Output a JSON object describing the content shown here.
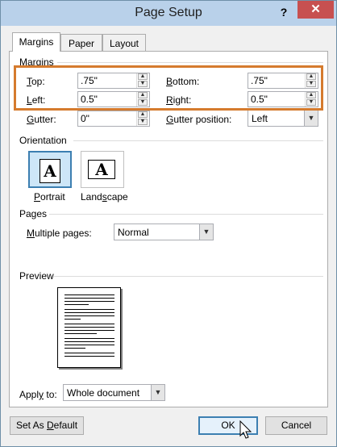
{
  "window": {
    "title": "Page Setup",
    "help_label": "?",
    "close_label": "✕"
  },
  "tabs": [
    {
      "label": "Margins",
      "active": true
    },
    {
      "label": "Paper",
      "active": false
    },
    {
      "label": "Layout",
      "active": false
    }
  ],
  "margins": {
    "section_label": "Margins",
    "top": {
      "label_first": "T",
      "label_rest": "op:",
      "value": ".75\""
    },
    "bottom": {
      "label_first": "B",
      "label_rest": "ottom:",
      "value": ".75\""
    },
    "left": {
      "label_first": "L",
      "label_rest": "eft:",
      "value": "0.5\""
    },
    "right": {
      "label_first": "R",
      "label_rest": "ight:",
      "value": "0.5\""
    },
    "gutter": {
      "label_first": "G",
      "label_rest": "utter:",
      "value": "0\""
    },
    "gutter_position": {
      "label_first": "G",
      "label_rest": "utter position:",
      "value": "Left"
    }
  },
  "orientation": {
    "section_label": "Orientation",
    "portrait": {
      "label_first": "P",
      "label_rest": "ortrait",
      "glyph": "A",
      "selected": true
    },
    "landscape": {
      "label_pre": "Land",
      "label_ul": "s",
      "label_post": "cape",
      "glyph": "A"
    }
  },
  "pages": {
    "section_label": "Pages",
    "multiple_pages": {
      "label_first": "M",
      "label_rest": "ultiple pages:",
      "value": "Normal"
    }
  },
  "preview": {
    "section_label": "Preview"
  },
  "apply_to": {
    "label_pre": "Appl",
    "label_ul": "y",
    "label_post": " to:",
    "value": "Whole document"
  },
  "buttons": {
    "default_pre": "Set As ",
    "default_ul": "D",
    "default_post": "efault",
    "ok": "OK",
    "cancel": "Cancel"
  },
  "colors": {
    "highlight": "#d57b2e",
    "titlebar": "#b9d1ea",
    "close": "#c75050",
    "accent": "#3c7fb1"
  }
}
